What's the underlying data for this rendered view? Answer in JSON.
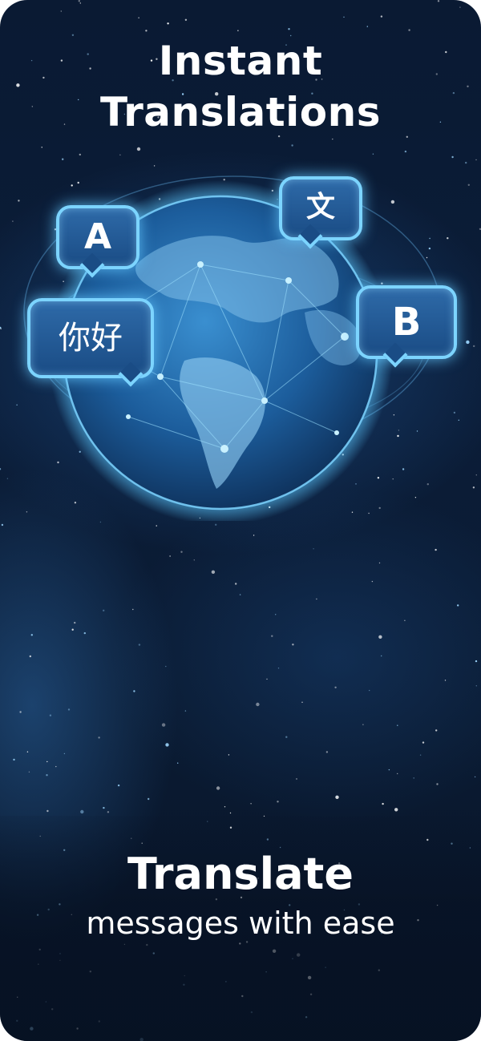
{
  "headline": {
    "line1": "Instant",
    "line2": "Translations"
  },
  "hero": {
    "bubbles": [
      {
        "label": "A",
        "icon": "letter-a"
      },
      {
        "label": "你好",
        "icon": "chinese-greeting"
      },
      {
        "label": "文",
        "icon": "translate-icon"
      },
      {
        "label": "B",
        "icon": "letter-b"
      }
    ],
    "globe_icon": "globe-icon"
  },
  "tagline": {
    "title": "Translate",
    "subtitle": "messages with ease"
  },
  "colors": {
    "background": "#0a1a33",
    "accent_glow": "#7cd4ff",
    "bubble_fill": "#1a4c85",
    "text": "#ffffff"
  }
}
